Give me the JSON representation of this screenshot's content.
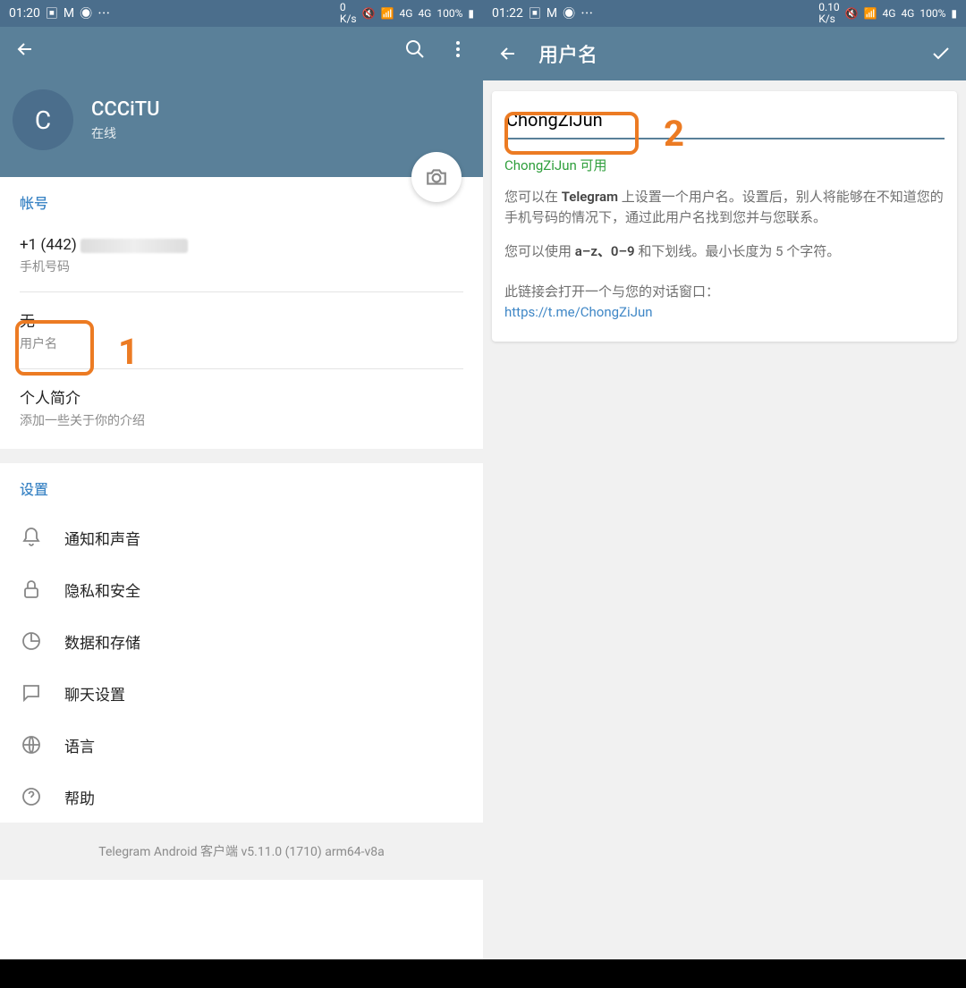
{
  "left": {
    "status": {
      "time": "01:20",
      "net": "K/s",
      "net_val": "0",
      "sig1": "4G",
      "sig2": "4G",
      "battery": "100%"
    },
    "profile": {
      "avatar_letter": "C",
      "name": "CCCiTU",
      "status": "在线"
    },
    "account_label": "帐号",
    "phone": {
      "value": "+1 (442)",
      "label": "手机号码"
    },
    "username": {
      "value": "无",
      "label": "用户名"
    },
    "bio": {
      "value": "个人简介",
      "label": "添加一些关于你的介绍"
    },
    "settings_label": "设置",
    "settings": [
      {
        "label": "通知和声音"
      },
      {
        "label": "隐私和安全"
      },
      {
        "label": "数据和存储"
      },
      {
        "label": "聊天设置"
      },
      {
        "label": "语言"
      },
      {
        "label": "帮助"
      }
    ],
    "version": "Telegram Android 客户端 v5.11.0 (1710) arm64-v8a"
  },
  "right": {
    "status": {
      "time": "01:22",
      "net": "K/s",
      "net_val": "0.10",
      "sig1": "4G",
      "sig2": "4G",
      "battery": "100%"
    },
    "title": "用户名",
    "input_value": "ChongZiJun",
    "available": "ChongZiJun 可用",
    "desc1_pre": "您可以在 ",
    "desc1_tg": "Telegram",
    "desc1_post": " 上设置一个用户名。设置后，别人将能够在不知道您的手机号码的情况下，通过此用户名找到您并与您联系。",
    "desc2_pre": "您可以使用 ",
    "desc2_rules": "a–z、0–9",
    "desc2_post": " 和下划线。最小长度为 5 个字符。",
    "linklabel": "此链接会打开一个与您的对话窗口：",
    "link": "https://t.me/ChongZiJun"
  },
  "annotations": {
    "n1": "1",
    "n2": "2"
  }
}
